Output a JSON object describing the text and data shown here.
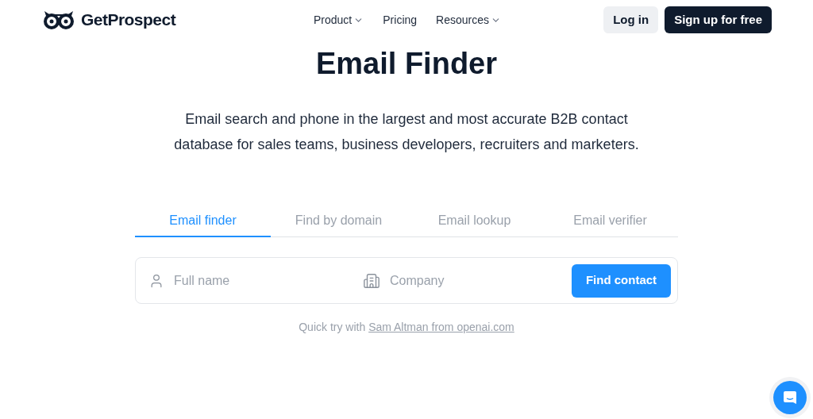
{
  "header": {
    "logo": "GetProspect",
    "nav": [
      {
        "label": "Product",
        "dropdown": true
      },
      {
        "label": "Pricing",
        "dropdown": false
      },
      {
        "label": "Resources",
        "dropdown": true
      }
    ],
    "login": "Log in",
    "signup": "Sign up for free"
  },
  "hero": {
    "title": "Email Finder",
    "subtitle": "Email search and phone in the largest and most accurate B2B contact database for sales teams, business developers, recruiters and marketers."
  },
  "tabs": [
    {
      "label": "Email finder",
      "selected": true
    },
    {
      "label": "Find by domain",
      "selected": false
    },
    {
      "label": "Email lookup",
      "selected": false
    },
    {
      "label": "Email verifier",
      "selected": false
    }
  ],
  "form": {
    "name_placeholder": "Full name",
    "company_placeholder": "Company",
    "button": "Find contact"
  },
  "quick_try": {
    "prefix": "Quick try with",
    "link": "Sam Altman from openai.com"
  }
}
